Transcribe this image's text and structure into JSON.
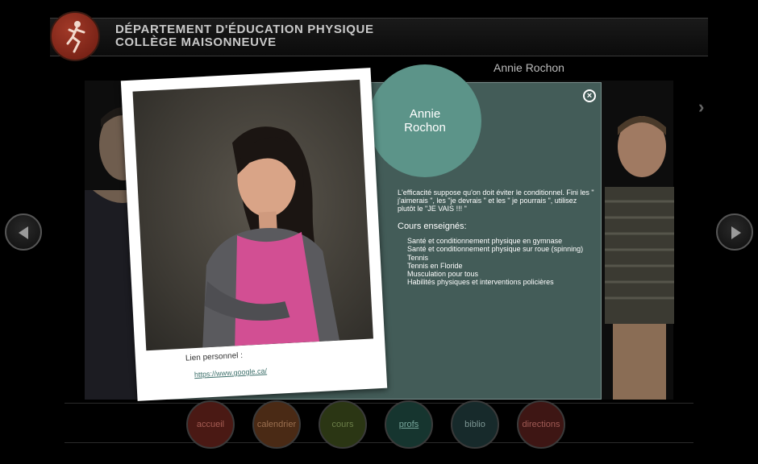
{
  "header": {
    "dept_line1": "DÉPARTEMENT D'ÉDUCATION PHYSIQUE",
    "dept_line2": "COLLÈGE MAISONNEUVE"
  },
  "current_name": "Annie Rochon",
  "profile": {
    "first_name": "Annie",
    "last_name": "Rochon",
    "quote": "L'efficacité suppose qu'on doit éviter le conditionnel. Fini les \" j'aimerais \", les \"je devrais \" et les \" je pourrais \", utilisez plutôt le \"JE VAIS !!! \"",
    "cours_title": "Cours enseignés:",
    "cours": [
      "Santé et conditionnement physique en gymnase",
      "Santé et conditionnement physique sur roue (spinning)",
      "Tennis",
      "Tennis en Floride",
      "Musculation pour tous",
      "Habilités physiques et interventions policières"
    ],
    "lien_label": "Lien personnel :",
    "lien_url": "https://www.google.ca/"
  },
  "nav": {
    "accueil": "accueil",
    "calendrier": "calendrier",
    "cours": "cours",
    "profs": "profs",
    "biblio": "biblio",
    "directions": "directions"
  },
  "icons": {
    "close": "close-icon",
    "left": "arrow-left-icon",
    "right": "arrow-right-icon",
    "chevron": "chevron-right-icon",
    "logo": "runner-logo-icon"
  },
  "colors": {
    "panel": "#435c58",
    "name_circle": "#5c9489",
    "link": "#3c6f6a"
  }
}
